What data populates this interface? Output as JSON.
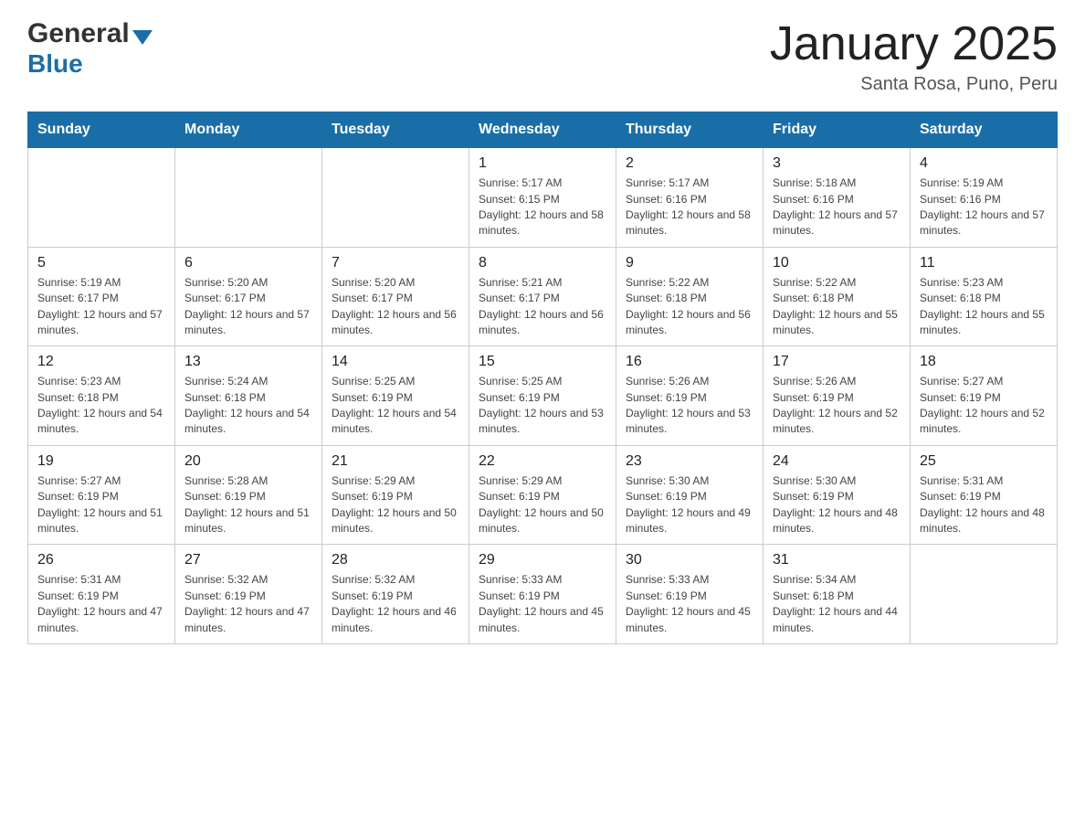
{
  "logo": {
    "general": "General",
    "blue": "Blue"
  },
  "header": {
    "title": "January 2025",
    "subtitle": "Santa Rosa, Puno, Peru"
  },
  "days": [
    "Sunday",
    "Monday",
    "Tuesday",
    "Wednesday",
    "Thursday",
    "Friday",
    "Saturday"
  ],
  "weeks": [
    [
      {
        "day": "",
        "info": ""
      },
      {
        "day": "",
        "info": ""
      },
      {
        "day": "",
        "info": ""
      },
      {
        "day": "1",
        "info": "Sunrise: 5:17 AM\nSunset: 6:15 PM\nDaylight: 12 hours and 58 minutes."
      },
      {
        "day": "2",
        "info": "Sunrise: 5:17 AM\nSunset: 6:16 PM\nDaylight: 12 hours and 58 minutes."
      },
      {
        "day": "3",
        "info": "Sunrise: 5:18 AM\nSunset: 6:16 PM\nDaylight: 12 hours and 57 minutes."
      },
      {
        "day": "4",
        "info": "Sunrise: 5:19 AM\nSunset: 6:16 PM\nDaylight: 12 hours and 57 minutes."
      }
    ],
    [
      {
        "day": "5",
        "info": "Sunrise: 5:19 AM\nSunset: 6:17 PM\nDaylight: 12 hours and 57 minutes."
      },
      {
        "day": "6",
        "info": "Sunrise: 5:20 AM\nSunset: 6:17 PM\nDaylight: 12 hours and 57 minutes."
      },
      {
        "day": "7",
        "info": "Sunrise: 5:20 AM\nSunset: 6:17 PM\nDaylight: 12 hours and 56 minutes."
      },
      {
        "day": "8",
        "info": "Sunrise: 5:21 AM\nSunset: 6:17 PM\nDaylight: 12 hours and 56 minutes."
      },
      {
        "day": "9",
        "info": "Sunrise: 5:22 AM\nSunset: 6:18 PM\nDaylight: 12 hours and 56 minutes."
      },
      {
        "day": "10",
        "info": "Sunrise: 5:22 AM\nSunset: 6:18 PM\nDaylight: 12 hours and 55 minutes."
      },
      {
        "day": "11",
        "info": "Sunrise: 5:23 AM\nSunset: 6:18 PM\nDaylight: 12 hours and 55 minutes."
      }
    ],
    [
      {
        "day": "12",
        "info": "Sunrise: 5:23 AM\nSunset: 6:18 PM\nDaylight: 12 hours and 54 minutes."
      },
      {
        "day": "13",
        "info": "Sunrise: 5:24 AM\nSunset: 6:18 PM\nDaylight: 12 hours and 54 minutes."
      },
      {
        "day": "14",
        "info": "Sunrise: 5:25 AM\nSunset: 6:19 PM\nDaylight: 12 hours and 54 minutes."
      },
      {
        "day": "15",
        "info": "Sunrise: 5:25 AM\nSunset: 6:19 PM\nDaylight: 12 hours and 53 minutes."
      },
      {
        "day": "16",
        "info": "Sunrise: 5:26 AM\nSunset: 6:19 PM\nDaylight: 12 hours and 53 minutes."
      },
      {
        "day": "17",
        "info": "Sunrise: 5:26 AM\nSunset: 6:19 PM\nDaylight: 12 hours and 52 minutes."
      },
      {
        "day": "18",
        "info": "Sunrise: 5:27 AM\nSunset: 6:19 PM\nDaylight: 12 hours and 52 minutes."
      }
    ],
    [
      {
        "day": "19",
        "info": "Sunrise: 5:27 AM\nSunset: 6:19 PM\nDaylight: 12 hours and 51 minutes."
      },
      {
        "day": "20",
        "info": "Sunrise: 5:28 AM\nSunset: 6:19 PM\nDaylight: 12 hours and 51 minutes."
      },
      {
        "day": "21",
        "info": "Sunrise: 5:29 AM\nSunset: 6:19 PM\nDaylight: 12 hours and 50 minutes."
      },
      {
        "day": "22",
        "info": "Sunrise: 5:29 AM\nSunset: 6:19 PM\nDaylight: 12 hours and 50 minutes."
      },
      {
        "day": "23",
        "info": "Sunrise: 5:30 AM\nSunset: 6:19 PM\nDaylight: 12 hours and 49 minutes."
      },
      {
        "day": "24",
        "info": "Sunrise: 5:30 AM\nSunset: 6:19 PM\nDaylight: 12 hours and 48 minutes."
      },
      {
        "day": "25",
        "info": "Sunrise: 5:31 AM\nSunset: 6:19 PM\nDaylight: 12 hours and 48 minutes."
      }
    ],
    [
      {
        "day": "26",
        "info": "Sunrise: 5:31 AM\nSunset: 6:19 PM\nDaylight: 12 hours and 47 minutes."
      },
      {
        "day": "27",
        "info": "Sunrise: 5:32 AM\nSunset: 6:19 PM\nDaylight: 12 hours and 47 minutes."
      },
      {
        "day": "28",
        "info": "Sunrise: 5:32 AM\nSunset: 6:19 PM\nDaylight: 12 hours and 46 minutes."
      },
      {
        "day": "29",
        "info": "Sunrise: 5:33 AM\nSunset: 6:19 PM\nDaylight: 12 hours and 45 minutes."
      },
      {
        "day": "30",
        "info": "Sunrise: 5:33 AM\nSunset: 6:19 PM\nDaylight: 12 hours and 45 minutes."
      },
      {
        "day": "31",
        "info": "Sunrise: 5:34 AM\nSunset: 6:18 PM\nDaylight: 12 hours and 44 minutes."
      },
      {
        "day": "",
        "info": ""
      }
    ]
  ]
}
